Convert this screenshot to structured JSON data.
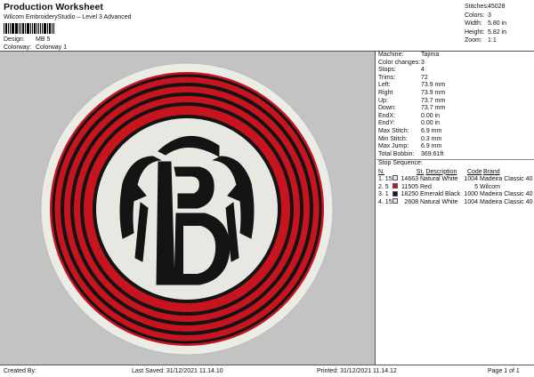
{
  "header": {
    "title": "Production Worksheet",
    "subtitle": "Wilcom EmbroideryStudio – Level 3 Advanced",
    "design_label": "Design:",
    "design_value": "MB 5",
    "colorway_label": "Colorway:",
    "colorway_value": "Colorway 1"
  },
  "summary": [
    {
      "label": "Stitches:",
      "value": "45028"
    },
    {
      "label": "Colors:",
      "value": "3"
    },
    {
      "label": "Width:",
      "value": "5.80 in"
    },
    {
      "label": "Height:",
      "value": "5.82 in"
    },
    {
      "label": "Zoom:",
      "value": "1:1"
    }
  ],
  "info": [
    {
      "label": "Machine:",
      "value": "Tajima"
    },
    {
      "label": "Color changes:",
      "value": "3"
    },
    {
      "label": "Stops:",
      "value": "4"
    },
    {
      "label": "Trims:",
      "value": "72"
    },
    {
      "label": "Left:",
      "value": "73.9 mm"
    },
    {
      "label": "Right",
      "value": "73.9 mm"
    },
    {
      "label": "Up:",
      "value": "73.7 mm"
    },
    {
      "label": "Down:",
      "value": "73.7 mm"
    },
    {
      "label": "EndX:",
      "value": "0.00 in"
    },
    {
      "label": "EndY:",
      "value": "0.00 in"
    },
    {
      "label": "Max Stitch:",
      "value": "6.9 mm"
    },
    {
      "label": "Min Stitch:",
      "value": "0.3 mm"
    },
    {
      "label": "Max Jump:",
      "value": "6.9 mm"
    },
    {
      "label": "Total Bobbin:",
      "value": "369.61ft"
    }
  ],
  "stop_sequence": {
    "title": "Stop Sequence:",
    "columns": {
      "n": "N.",
      "st": "St.",
      "desc": "Description",
      "code": "Code",
      "brand": "Brand"
    },
    "rows": [
      {
        "n": "1.",
        "seq": "15",
        "color": "#e6e6e0",
        "st": "14663",
        "desc": "Natural White",
        "code": "1004",
        "brand": "Madeira Classic 40"
      },
      {
        "n": "2.",
        "seq": "5",
        "color": "#c8141e",
        "st": "11505",
        "desc": "Red",
        "code": "5",
        "brand": "Wilcom"
      },
      {
        "n": "3.",
        "seq": "1",
        "color": "#161616",
        "st": "18250",
        "desc": "Emerald Black",
        "code": "1000",
        "brand": "Madeira Classic 40"
      },
      {
        "n": "4.",
        "seq": "15",
        "color": "#e6e6e0",
        "st": "2608",
        "desc": "Natural White",
        "code": "1004",
        "brand": "Madeira Classic 40"
      }
    ]
  },
  "footer": {
    "created_by": "Created By:",
    "last_saved": "Last Saved: 31/12/2021 11.14.10",
    "printed": "Printed: 31/12/2021 11.14.12",
    "page": "Page 1 of 1"
  },
  "design_colors": {
    "background": "#c3c3c3",
    "outer_white": "#ecece6",
    "red": "#c8141e",
    "black": "#141414",
    "inner_white": "#e8e8e3"
  }
}
